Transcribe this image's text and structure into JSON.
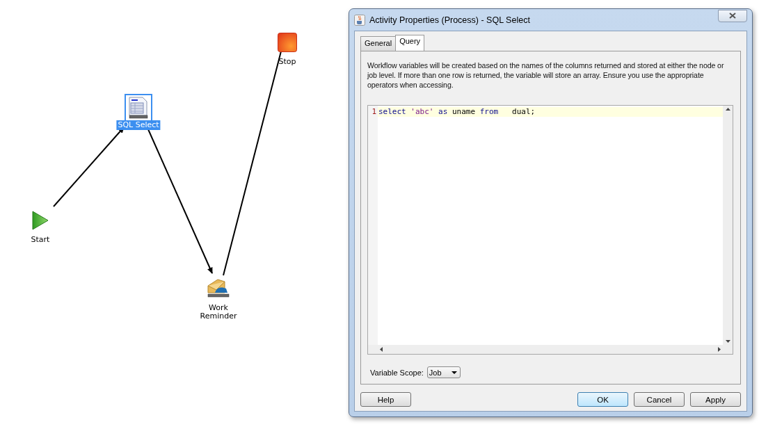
{
  "canvas": {
    "nodes": [
      {
        "label": "Start",
        "kind": "start",
        "selected": false
      },
      {
        "label": "SQL Select",
        "kind": "sql",
        "selected": true
      },
      {
        "label": "Work Reminder",
        "kind": "reminder",
        "selected": false
      },
      {
        "label": "Stop",
        "kind": "stop",
        "selected": false
      }
    ],
    "edges": [
      {
        "kind": "arrow"
      },
      {
        "kind": "arrow"
      },
      {
        "kind": "arrow"
      }
    ]
  },
  "dialog": {
    "title": "Activity Properties (Process) - SQL Select",
    "tabs": [
      {
        "label": "General",
        "selected": false
      },
      {
        "label": "Query",
        "selected": true
      }
    ],
    "description": "Workflow variables will be created based on the names of the columns returned and stored at either the node or job level. If more than one row is returned, the variable will store an array. Ensure you use the appropriate operators when accessing.",
    "editor": {
      "lines": [
        {
          "number": "1",
          "current": true,
          "tokens": [
            {
              "text": "select",
              "kind": "keyword"
            },
            {
              "text": " 'abc' ",
              "kind": "string"
            },
            {
              "text": "as",
              "kind": "keyword"
            },
            {
              "text": " uname ",
              "kind": "plain"
            },
            {
              "text": "from",
              "kind": "keyword"
            },
            {
              "text": "   dual;",
              "kind": "plain"
            }
          ]
        }
      ]
    },
    "scope": {
      "label": "Variable Scope:",
      "value": "Job"
    },
    "buttons": [
      {
        "label": "Help",
        "default": false
      },
      {
        "label": "OK",
        "default": true
      },
      {
        "label": "Cancel",
        "default": false
      },
      {
        "label": "Apply",
        "default": false
      }
    ]
  }
}
